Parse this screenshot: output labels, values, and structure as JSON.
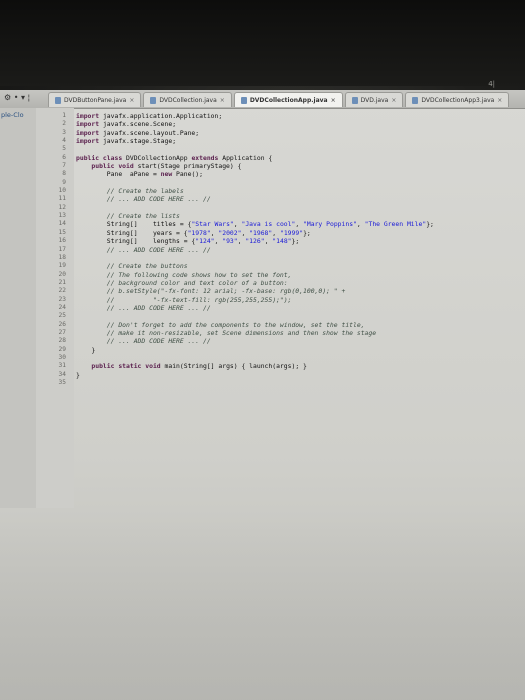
{
  "toolbar": {
    "icons": [
      "⚙",
      "•",
      "▾",
      "¦"
    ]
  },
  "tabs": [
    {
      "label": "DVDButtonPane.java",
      "active": false
    },
    {
      "label": "DVDCollection.java",
      "active": false
    },
    {
      "label": "DVDCollectionApp.java",
      "active": true
    },
    {
      "label": "DVD.java",
      "active": false
    },
    {
      "label": "DVDCollectionApp3.java",
      "active": false
    }
  ],
  "side_panel": {
    "label": "ple-Clo"
  },
  "status_right": "4|",
  "line_numbers": [
    "1",
    "2",
    "3",
    "4",
    "5",
    "6",
    "7",
    "8",
    "9",
    "10",
    "11",
    "12",
    "13",
    "14",
    "15",
    "16",
    "17",
    "18",
    "19",
    "20",
    "21",
    "22",
    "23",
    "24",
    "25",
    "26",
    "27",
    "28",
    "29",
    "30",
    "31",
    "34",
    "35"
  ],
  "code_lines": [
    [
      {
        "t": "kw",
        "v": "import"
      },
      {
        "t": "pl",
        "v": " javafx.application.Application;"
      }
    ],
    [
      {
        "t": "kw",
        "v": "import"
      },
      {
        "t": "pl",
        "v": " javafx.scene.Scene;"
      }
    ],
    [
      {
        "t": "kw",
        "v": "import"
      },
      {
        "t": "pl",
        "v": " javafx.scene.layout.Pane;"
      }
    ],
    [
      {
        "t": "kw",
        "v": "import"
      },
      {
        "t": "pl",
        "v": " javafx.stage.Stage;"
      }
    ],
    [],
    [
      {
        "t": "kw",
        "v": "public class"
      },
      {
        "t": "pl",
        "v": " DVDCollectionApp "
      },
      {
        "t": "kw",
        "v": "extends"
      },
      {
        "t": "pl",
        "v": " Application {"
      }
    ],
    [
      {
        "t": "pl",
        "v": "    "
      },
      {
        "t": "kw",
        "v": "public void"
      },
      {
        "t": "pl",
        "v": " start(Stage primaryStage) {"
      }
    ],
    [
      {
        "t": "pl",
        "v": "        Pane  aPane = "
      },
      {
        "t": "kw",
        "v": "new"
      },
      {
        "t": "pl",
        "v": " Pane();"
      }
    ],
    [],
    [
      {
        "t": "cm",
        "v": "        // Create the labels"
      }
    ],
    [
      {
        "t": "cm",
        "v": "        // ... ADD CODE HERE ... //"
      }
    ],
    [],
    [
      {
        "t": "cm",
        "v": "        // Create the lists"
      }
    ],
    [
      {
        "t": "pl",
        "v": "        String[]    titles = {"
      },
      {
        "t": "st",
        "v": "\"Star Wars\""
      },
      {
        "t": "pl",
        "v": ", "
      },
      {
        "t": "st",
        "v": "\"Java is cool\""
      },
      {
        "t": "pl",
        "v": ", "
      },
      {
        "t": "st",
        "v": "\"Mary Poppins\""
      },
      {
        "t": "pl",
        "v": ", "
      },
      {
        "t": "st",
        "v": "\"The Green Mile\""
      },
      {
        "t": "pl",
        "v": "};"
      }
    ],
    [
      {
        "t": "pl",
        "v": "        String[]    years = {"
      },
      {
        "t": "st",
        "v": "\"1978\""
      },
      {
        "t": "pl",
        "v": ", "
      },
      {
        "t": "st",
        "v": "\"2002\""
      },
      {
        "t": "pl",
        "v": ", "
      },
      {
        "t": "st",
        "v": "\"1968\""
      },
      {
        "t": "pl",
        "v": ", "
      },
      {
        "t": "st",
        "v": "\"1999\""
      },
      {
        "t": "pl",
        "v": "};"
      }
    ],
    [
      {
        "t": "pl",
        "v": "        String[]    lengths = {"
      },
      {
        "t": "st",
        "v": "\"124\""
      },
      {
        "t": "pl",
        "v": ", "
      },
      {
        "t": "st",
        "v": "\"93\""
      },
      {
        "t": "pl",
        "v": ", "
      },
      {
        "t": "st",
        "v": "\"126\""
      },
      {
        "t": "pl",
        "v": ", "
      },
      {
        "t": "st",
        "v": "\"148\""
      },
      {
        "t": "pl",
        "v": "};"
      }
    ],
    [
      {
        "t": "cm",
        "v": "        // ... ADD CODE HERE ... //"
      }
    ],
    [],
    [
      {
        "t": "cm",
        "v": "        // Create the buttons"
      }
    ],
    [
      {
        "t": "cm",
        "v": "        // The following code shows how to set the font,"
      }
    ],
    [
      {
        "t": "cm",
        "v": "        // background color and text color of a button:"
      }
    ],
    [
      {
        "t": "cm",
        "v": "        // b.setStyle(\"-fx-font: 12 arial; -fx-base: rgb(0,100,0); \" +"
      }
    ],
    [
      {
        "t": "cm",
        "v": "        //          \"-fx-text-fill: rgb(255,255,255);\");"
      }
    ],
    [
      {
        "t": "cm",
        "v": "        // ... ADD CODE HERE ... //"
      }
    ],
    [],
    [
      {
        "t": "cm",
        "v": "        // Don't forget to add the components to the window, set the title,"
      }
    ],
    [
      {
        "t": "cm",
        "v": "        // make it non-resizable, set Scene dimensions and then show the stage"
      }
    ],
    [
      {
        "t": "cm",
        "v": "        // ... ADD CODE HERE ... //"
      }
    ],
    [
      {
        "t": "pl",
        "v": "    }"
      }
    ],
    [],
    [
      {
        "t": "pl",
        "v": "    "
      },
      {
        "t": "kw",
        "v": "public static void"
      },
      {
        "t": "pl",
        "v": " main(String[] args) { launch(args); }"
      }
    ],
    [
      {
        "t": "pl",
        "v": "}"
      }
    ],
    []
  ]
}
